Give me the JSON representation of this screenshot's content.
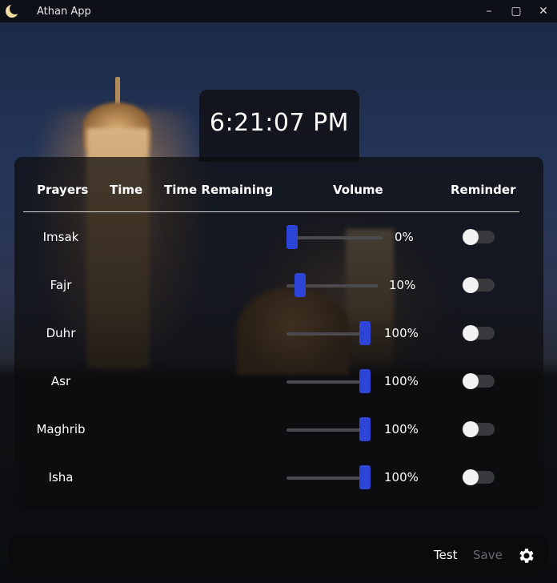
{
  "window": {
    "title": "Athan App",
    "controls": {
      "minimize": "–",
      "maximize": "▢",
      "close": "✕"
    }
  },
  "clock": {
    "time": "6:21:07 PM"
  },
  "table": {
    "headers": {
      "prayers": "Prayers",
      "time": "Time",
      "time_remaining": "Time Remaining",
      "volume": "Volume",
      "reminder": "Reminder"
    },
    "rows": [
      {
        "name": "Imsak",
        "volume": 0,
        "volume_label": "0%",
        "reminder": false
      },
      {
        "name": "Fajr",
        "volume": 10,
        "volume_label": "10%",
        "reminder": false
      },
      {
        "name": "Duhr",
        "volume": 100,
        "volume_label": "100%",
        "reminder": false
      },
      {
        "name": "Asr",
        "volume": 100,
        "volume_label": "100%",
        "reminder": false
      },
      {
        "name": "Maghrib",
        "volume": 100,
        "volume_label": "100%",
        "reminder": false
      },
      {
        "name": "Isha",
        "volume": 100,
        "volume_label": "100%",
        "reminder": false
      }
    ]
  },
  "footer": {
    "test_label": "Test",
    "save_label": "Save",
    "settings_icon": "gear-icon"
  },
  "colors": {
    "accent": "#2c45d6",
    "panel": "#0c0c0e",
    "disabled_text": "#6a6a6e"
  }
}
